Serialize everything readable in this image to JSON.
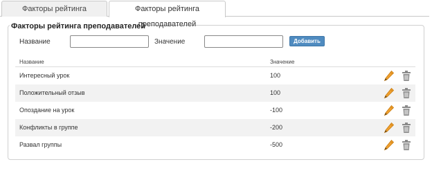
{
  "tabs": [
    {
      "label": "Факторы рейтинга сотрудников",
      "active": false
    },
    {
      "label": "Факторы рейтинга преподавателей",
      "active": true
    }
  ],
  "panel": {
    "title": "Факторы рейтинга преподавателей"
  },
  "form": {
    "name_label": "Название",
    "name_value": "",
    "value_label": "Значение",
    "value_value": "",
    "add_label": "Добавить"
  },
  "table": {
    "columns": [
      "Название",
      "Значение"
    ],
    "rows": [
      {
        "name": "Интересный урок",
        "value": "100"
      },
      {
        "name": "Положительный отзыв",
        "value": "100"
      },
      {
        "name": "Опоздание на урок",
        "value": "-100"
      },
      {
        "name": "Конфликты в группе",
        "value": "-200"
      },
      {
        "name": "Развал группы",
        "value": "-500"
      }
    ]
  },
  "icons": {
    "edit": "pencil-icon",
    "delete": "trash-icon"
  },
  "colors": {
    "accent_button": "#4f8bc0",
    "pencil": "#f0a030",
    "trash": "#8a8a8a",
    "row_alt": "#f2f2f2"
  }
}
